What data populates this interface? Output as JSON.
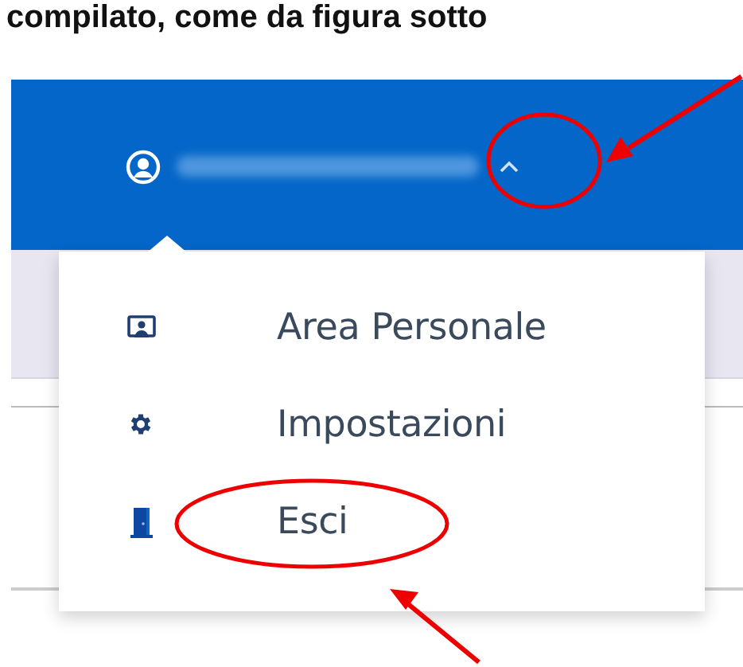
{
  "caption": "compilato, come da figura sotto",
  "header": {
    "menu_expanded": true
  },
  "menu": {
    "items": [
      {
        "kind": "profile",
        "label": "Area Personale"
      },
      {
        "kind": "settings",
        "label": "Impostazioni"
      },
      {
        "kind": "logout",
        "label": "Esci"
      }
    ]
  }
}
